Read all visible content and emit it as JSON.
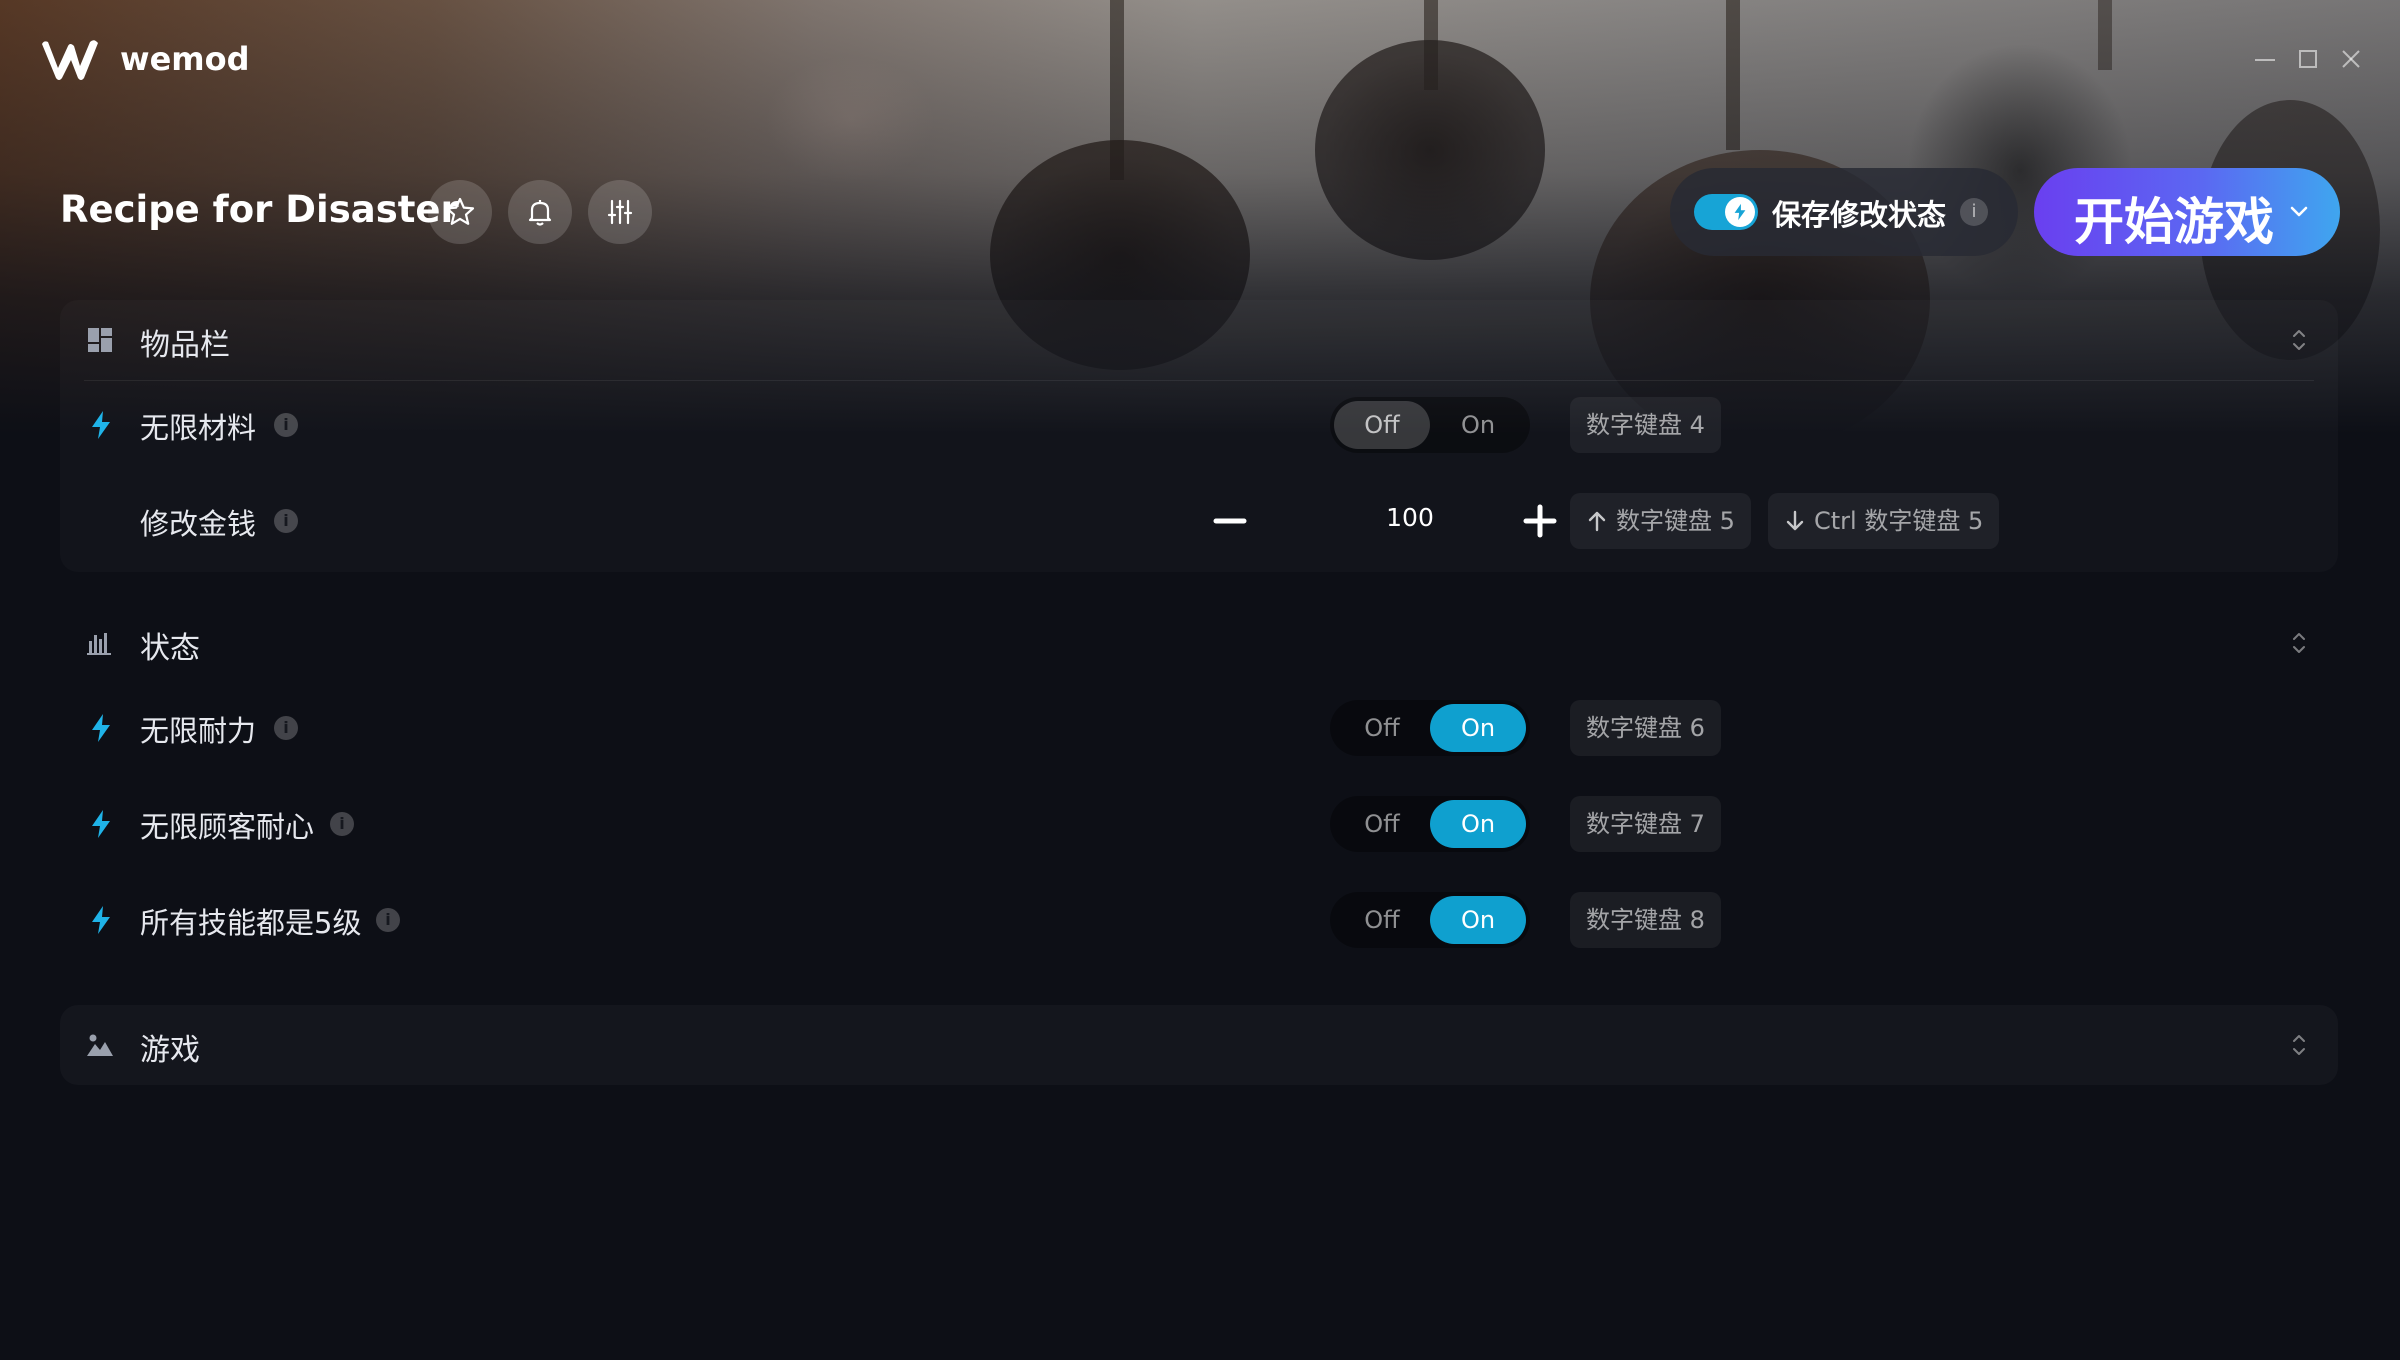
{
  "app": {
    "name": "wemod"
  },
  "game": {
    "title": "Recipe for Disaster"
  },
  "header": {
    "save_mods_label": "保存修改状态",
    "save_mods_info": "i",
    "play_label": "开始游戏"
  },
  "toggle_labels": {
    "off": "Off",
    "on": "On"
  },
  "sections": [
    {
      "title": "物品栏",
      "icon": "grid-icon",
      "rows": [
        {
          "label": "无限材料",
          "type": "toggle",
          "state": "Off",
          "hotkey": "数字键盘 4"
        },
        {
          "label": "修改金钱",
          "type": "number",
          "value": "100",
          "hotkey_up": "数字键盘 5",
          "hotkey_down": "Ctrl 数字键盘 5"
        }
      ]
    },
    {
      "title": "状态",
      "icon": "bar-chart-icon",
      "rows": [
        {
          "label": "无限耐力",
          "type": "toggle",
          "state": "On",
          "hotkey": "数字键盘 6"
        },
        {
          "label": "无限顾客耐心",
          "type": "toggle",
          "state": "On",
          "hotkey": "数字键盘 7"
        },
        {
          "label": "所有技能都是5级",
          "type": "toggle",
          "state": "On",
          "hotkey": "数字键盘 8"
        }
      ]
    },
    {
      "title": "游戏",
      "icon": "landscape-icon",
      "rows": []
    }
  ],
  "info_glyph": "i",
  "colors": {
    "accent": "#0fa0cf",
    "bolt": "#1fb3e8",
    "play_start": "#6a3ff0",
    "play_end": "#3fa6ef",
    "background": "#0d0f16"
  }
}
